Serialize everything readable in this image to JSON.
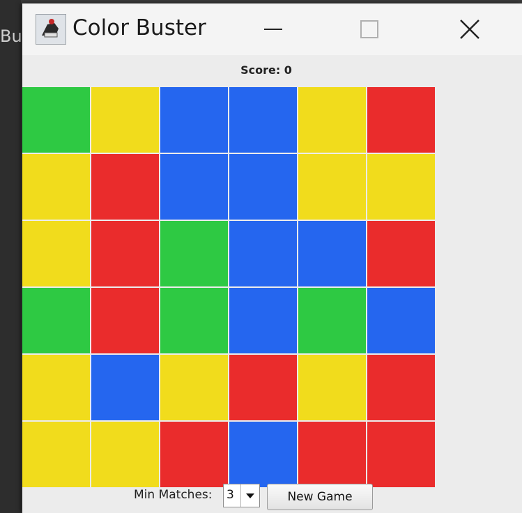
{
  "backdrop": {
    "partial_text": "Bu"
  },
  "window": {
    "title": "Color Buster",
    "icon": "app-logo-icon",
    "controls": [
      "minimize-icon",
      "maximize-icon",
      "close-icon"
    ]
  },
  "score": {
    "label": "Score: 0"
  },
  "board": {
    "rows": 6,
    "cols": 6,
    "colors": {
      "green": "#2ec943",
      "yellow": "#f1dc1c",
      "blue": "#2566ef",
      "red": "#ea2c2c"
    },
    "grid": [
      [
        "green",
        "yellow",
        "blue",
        "blue",
        "yellow",
        "red"
      ],
      [
        "yellow",
        "red",
        "blue",
        "blue",
        "yellow",
        "yellow"
      ],
      [
        "yellow",
        "red",
        "green",
        "blue",
        "blue",
        "red"
      ],
      [
        "green",
        "red",
        "green",
        "blue",
        "green",
        "blue"
      ],
      [
        "yellow",
        "blue",
        "yellow",
        "red",
        "yellow",
        "red"
      ],
      [
        "yellow",
        "yellow",
        "red",
        "blue",
        "red",
        "red"
      ]
    ]
  },
  "controls": {
    "min_matches_label": "Min Matches:",
    "min_matches_value": "3",
    "new_game_label": "New Game"
  }
}
